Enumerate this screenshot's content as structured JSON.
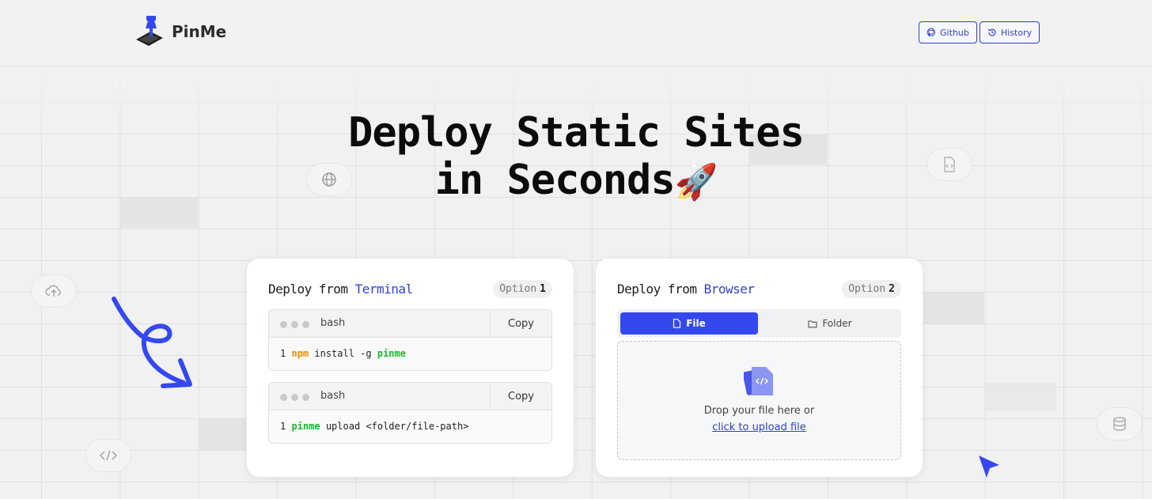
{
  "header": {
    "brand": "PinMe",
    "github_label": "Github",
    "history_label": "History"
  },
  "hero": {
    "line1": "Deploy Static Sites",
    "line2": "in Seconds",
    "emoji": "🚀"
  },
  "terminal_card": {
    "title_prefix": "Deploy from ",
    "title_accent": "Terminal",
    "option_label": "Option",
    "option_number": "1",
    "blocks": [
      {
        "lang": "bash",
        "copy_label": "Copy",
        "line_no": "1",
        "cmd": "npm",
        "rest": " install -g ",
        "arg": "pinme"
      },
      {
        "lang": "bash",
        "copy_label": "Copy",
        "line_no": "1",
        "cmd": "pinme",
        "rest": " upload <folder/file-path>"
      }
    ]
  },
  "browser_card": {
    "title_prefix": "Deploy from ",
    "title_accent": "Browser",
    "option_label": "Option",
    "option_number": "2",
    "tabs": [
      {
        "label": "File",
        "icon": "file-icon",
        "active": true
      },
      {
        "label": "Folder",
        "icon": "folder-icon",
        "active": false
      }
    ],
    "drop_text": "Drop your file here or",
    "drop_link": "click to upload file"
  },
  "colors": {
    "accent": "#3548f0",
    "link": "#2f3fd8",
    "npm": "#f08a00",
    "pinme": "#1ab82a"
  },
  "icons": [
    "globe-icon",
    "code-file-icon",
    "cloud-upload-icon",
    "code-brackets-icon",
    "database-icon",
    "arrow-doodle-icon",
    "cursor-pointer-icon"
  ]
}
